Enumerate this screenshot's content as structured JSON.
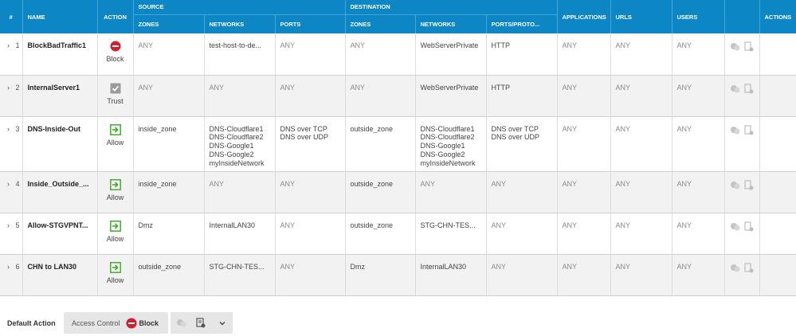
{
  "header": {
    "groups": {
      "source": "SOURCE",
      "destination": "DESTINATION"
    },
    "columns": {
      "num": "#",
      "name": "NAME",
      "action": "ACTION",
      "src_zones": "ZONES",
      "src_networks": "NETWORKS",
      "src_ports": "PORTS",
      "dst_zones": "ZONES",
      "dst_networks": "NETWORKS",
      "dst_ports": "PORTS/PROTO...",
      "applications": "APPLICATIONS",
      "urls": "URLS",
      "users": "USERS",
      "actions": "ACTIONS"
    }
  },
  "rules": [
    {
      "num": "1",
      "name": "BlockBadTraffic1",
      "action": "Block",
      "action_icon": "block-icon",
      "src_zones": "ANY",
      "src_networks": "test-host-to-de...",
      "src_ports": "ANY",
      "dst_zones": "ANY",
      "dst_networks": "WebServerPrivate",
      "dst_ports": "HTTP",
      "applications": "ANY",
      "urls": "ANY",
      "users": "ANY"
    },
    {
      "num": "2",
      "name": "InternalServer1",
      "action": "Trust",
      "action_icon": "trust-icon",
      "src_zones": "ANY",
      "src_networks": "ANY",
      "src_ports": "ANY",
      "dst_zones": "ANY",
      "dst_networks": "WebServerPrivate",
      "dst_ports": "HTTP",
      "applications": "ANY",
      "urls": "ANY",
      "users": "ANY"
    },
    {
      "num": "3",
      "name": "DNS-Inside-Out",
      "action": "Allow",
      "action_icon": "allow-icon",
      "src_zones": "inside_zone",
      "src_networks": "DNS-Cloudflare1\nDNS-Cloudflare2\nDNS-Google1\nDNS-Google2\nmyInsideNetwork",
      "src_ports": "DNS over TCP\nDNS over UDP",
      "dst_zones": "outside_zone",
      "dst_networks": "DNS-Cloudflare1\nDNS-Cloudflare2\nDNS-Google1\nDNS-Google2\nmyInsideNetwork",
      "dst_ports": "DNS over TCP\nDNS over UDP",
      "applications": "ANY",
      "urls": "ANY",
      "users": "ANY"
    },
    {
      "num": "4",
      "name": "Inside_Outside_...",
      "action": "Allow",
      "action_icon": "allow-icon",
      "src_zones": "inside_zone",
      "src_networks": "ANY",
      "src_ports": "ANY",
      "dst_zones": "outside_zone",
      "dst_networks": "ANY",
      "dst_ports": "ANY",
      "applications": "ANY",
      "urls": "ANY",
      "users": "ANY"
    },
    {
      "num": "5",
      "name": "Allow-STGVPNT...",
      "action": "Allow",
      "action_icon": "allow-icon",
      "src_zones": "Dmz",
      "src_networks": "InternalLAN30",
      "src_ports": "ANY",
      "dst_zones": "outside_zone",
      "dst_networks": "STG-CHN-TES...",
      "dst_ports": "ANY",
      "applications": "ANY",
      "urls": "ANY",
      "users": "ANY"
    },
    {
      "num": "6",
      "name": "CHN to LAN30",
      "action": "Allow",
      "action_icon": "allow-icon",
      "src_zones": "outside_zone",
      "src_networks": "STG-CHN-TES...",
      "src_ports": "ANY",
      "dst_zones": "Dmz",
      "dst_networks": "InternalLAN30",
      "dst_ports": "ANY",
      "applications": "ANY",
      "urls": "ANY",
      "users": "ANY"
    }
  ],
  "footer": {
    "label": "Default Action",
    "access_control": "Access Control",
    "action": "Block"
  },
  "colors": {
    "header_bg": "#0d86c5",
    "block": "#cf2030",
    "allow": "#3fae29",
    "trust": "#9b9b9b"
  }
}
